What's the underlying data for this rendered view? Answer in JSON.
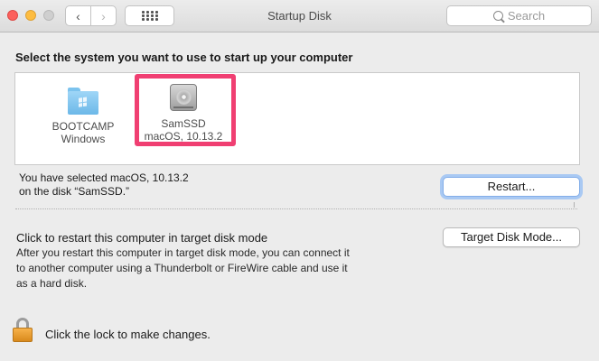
{
  "window": {
    "title": "Startup Disk",
    "search_placeholder": "Search"
  },
  "toolbar": {
    "back_glyph": "‹",
    "forward_glyph": "›",
    "show_all_icon": "grid-icon"
  },
  "main": {
    "heading": "Select the system you want to use to start up your computer",
    "disks": [
      {
        "name": "BOOTCAMP",
        "os": "Windows",
        "icon": "folder-windows-icon",
        "selected": false
      },
      {
        "name": "SamSSD",
        "os": "macOS, 10.13.2",
        "icon": "hard-drive-icon",
        "selected": true
      }
    ],
    "selection_line1": "You have selected macOS, 10.13.2",
    "selection_line2": "on the disk “SamSSD.”",
    "restart_label": "Restart...",
    "target_mode_title": "Click to restart this computer in target disk mode",
    "target_mode_desc": "After you restart this computer in target disk mode, you can connect it to another computer using a Thunderbolt or FireWire cable and use it as a hard disk.",
    "target_mode_button": "Target Disk Mode..."
  },
  "footer": {
    "lock_text": "Click the lock to make changes."
  },
  "colors": {
    "highlight": "#f03f72",
    "focus_ring": "#a9c9f3"
  }
}
